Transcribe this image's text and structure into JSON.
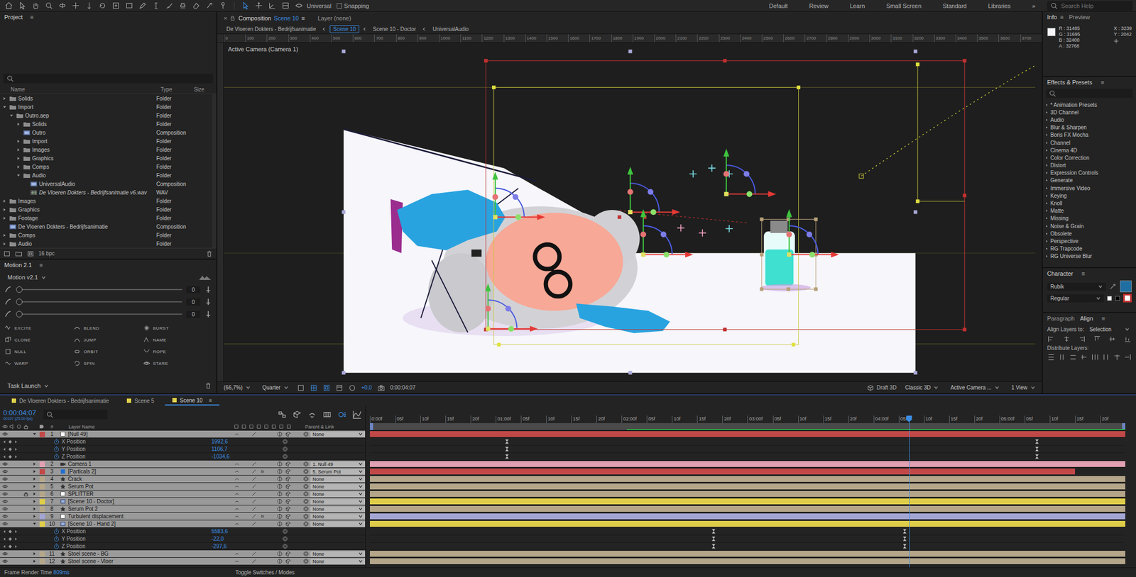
{
  "toolbar": {
    "universal": "Universal",
    "snapping": {
      "label": "Snapping",
      "checked": false
    },
    "workspaces": [
      "Default",
      "Review",
      "Learn",
      "Small Screen",
      "Standard",
      "Libraries"
    ],
    "more": "»",
    "search_placeholder": "Search Help"
  },
  "project": {
    "title": "Project",
    "menu": "≡",
    "columns": [
      "Name",
      "Type",
      "Size"
    ],
    "items": [
      {
        "name": "Solids",
        "type": "Folder",
        "kind": "folder",
        "expanded": false,
        "missing": false
      },
      {
        "name": "Import",
        "type": "Folder",
        "kind": "folder",
        "expanded": true,
        "missing": false,
        "children": [
          {
            "name": "Outro.aep",
            "type": "Folder",
            "kind": "folder",
            "expanded": true,
            "missing": false,
            "children": [
              {
                "name": "Solids",
                "type": "Folder",
                "kind": "folder",
                "expanded": false,
                "missing": false
              },
              {
                "name": "Outro",
                "type": "Composition",
                "kind": "comp",
                "missing": false
              },
              {
                "name": "Import",
                "type": "Folder",
                "kind": "folder",
                "expanded": false,
                "missing": false
              },
              {
                "name": "Images",
                "type": "Folder",
                "kind": "folder",
                "expanded": false,
                "missing": false
              },
              {
                "name": "Graphics",
                "type": "Folder",
                "kind": "folder",
                "expanded": false,
                "missing": false
              },
              {
                "name": "Comps",
                "type": "Folder",
                "kind": "folder",
                "expanded": false,
                "missing": false
              },
              {
                "name": "Audio",
                "type": "Folder",
                "kind": "folder",
                "expanded": true,
                "missing": false,
                "children": [
                  {
                    "name": "UniversalAudio",
                    "type": "Composition",
                    "kind": "comp",
                    "missing": false
                  },
                  {
                    "name": "De Vloeren Dokters - Bedrijfsanimatie v6.wav",
                    "type": "WAV",
                    "kind": "audio",
                    "missing": true
                  }
                ]
              }
            ]
          }
        ]
      },
      {
        "name": "Images",
        "type": "Folder",
        "kind": "folder",
        "expanded": false,
        "missing": false
      },
      {
        "name": "Graphics",
        "type": "Folder",
        "kind": "folder",
        "expanded": false,
        "missing": false
      },
      {
        "name": "Footage",
        "type": "Folder",
        "kind": "folder",
        "expanded": false,
        "missing": false
      },
      {
        "name": "De Vloeren Dokters - Bedrijfsanimatie",
        "type": "Composition",
        "kind": "comp",
        "missing": false
      },
      {
        "name": "Comps",
        "type": "Folder",
        "kind": "folder",
        "expanded": false,
        "missing": false
      },
      {
        "name": "Audio",
        "type": "Folder",
        "kind": "folder",
        "expanded": false,
        "missing": false
      }
    ],
    "footer_bpc": "16 bpc"
  },
  "motion": {
    "title": "Motion 2.1",
    "menu": "≡",
    "preset": "Motion v2.1",
    "sliders": [
      {
        "value": "0",
        "level": 0
      },
      {
        "value": "0",
        "level": 0
      },
      {
        "value": "0",
        "level": 0
      }
    ],
    "buttons": [
      "EXCITE",
      "BLEND",
      "BURST",
      "CLONE",
      "JUMP",
      "NAME",
      "NULL",
      "ORBIT",
      "ROPE",
      "WARP",
      "SPIN",
      "STARE"
    ],
    "task": "Task Launch"
  },
  "viewer": {
    "tabs": [
      {
        "label": "Composition",
        "sub": "Scene 10",
        "close": "×",
        "menu": "≡",
        "selected": true
      },
      {
        "label": "Layer (none)",
        "sub": "",
        "close": "",
        "menu": "",
        "selected": false
      }
    ],
    "breadcrumbs": [
      {
        "label": "De Vloeren Dokters - Bedrijfsanimatie",
        "selected": false
      },
      {
        "label": "Scene 10",
        "selected": true
      },
      {
        "label": "Scene 10 - Doctor",
        "selected": false
      },
      {
        "label": "UniversalAudio",
        "selected": false
      }
    ],
    "ruler": [
      "0",
      "100",
      "200",
      "300",
      "400",
      "500",
      "600",
      "700",
      "800",
      "900",
      "1000",
      "1100",
      "1200",
      "1300",
      "1400",
      "1500",
      "1600",
      "1700",
      "1800",
      "1900",
      "2000",
      "2100",
      "2200",
      "2300",
      "2400",
      "2500",
      "2600",
      "2700",
      "2800",
      "2900",
      "3000",
      "3100",
      "3200",
      "3300",
      "3400",
      "3500",
      "3600",
      "3700"
    ],
    "camera_label": "Active Camera (Camera 1)",
    "footer": {
      "zoom": "(66,7%)",
      "resolution": "Quarter",
      "exposure": "+0,0",
      "time": "0:00:04:07",
      "draft": "Draft 3D",
      "renderer": "Classic 3D",
      "view": "Active Camera ...",
      "layout": "1 View"
    }
  },
  "info": {
    "tabs": [
      {
        "label": "Info",
        "menu": "≡",
        "selected": true
      },
      {
        "label": "Preview",
        "menu": "",
        "selected": false
      }
    ],
    "sample_color": "#f5f6fa",
    "channels": [
      {
        "label": "R :",
        "value": "31485"
      },
      {
        "label": "G :",
        "value": "31695"
      },
      {
        "label": "B :",
        "value": "32400"
      },
      {
        "label": "A :",
        "value": "32768"
      }
    ],
    "coords": [
      {
        "label": "X :",
        "value": "3239"
      },
      {
        "label": "Y :",
        "value": "2042"
      }
    ]
  },
  "effects": {
    "title": "Effects & Presets",
    "menu": "≡",
    "search_placeholder": "",
    "items": [
      "* Animation Presets",
      "3D Channel",
      "Audio",
      "Blur & Sharpen",
      "Boris FX Mocha",
      "Channel",
      "Cinema 4D",
      "Color Correction",
      "Distort",
      "Expression Controls",
      "Generate",
      "Immersive Video",
      "Keying",
      "Knoll",
      "Matte",
      "Missing",
      "Noise & Grain",
      "Obsolete",
      "Perspective",
      "RG Trapcode",
      "RG Universe Blur"
    ]
  },
  "character": {
    "title": "Character",
    "menu": "≡",
    "font": "Rubik",
    "style": "Regular",
    "fill_color": "#1f6fa3"
  },
  "align": {
    "tabs": [
      {
        "label": "Paragraph",
        "selected": false
      },
      {
        "label": "Align",
        "selected": true
      }
    ],
    "menu": "≡",
    "align_to_label": "Align Layers to:",
    "align_to": "Selection",
    "distribute_label": "Distribute Layers:"
  },
  "timeline": {
    "tabs": [
      {
        "label": "De Vloeren Dokters - Bedrijfsanimatie",
        "selected": false
      },
      {
        "label": "Scene 5",
        "selected": false
      },
      {
        "label": "Scene 10",
        "menu": "≡",
        "selected": true
      }
    ],
    "time": "0:00:04:07",
    "frame_info": "00107 (25.00 fps)",
    "search_placeholder": "",
    "columns": {
      "index": "#",
      "name": "Layer Name",
      "parent": "Parent & Link"
    },
    "ruler": [
      "0:00f",
      "05f",
      "10f",
      "15f",
      "20f",
      "01:00f",
      "05f",
      "10f",
      "15f",
      "20f",
      "02:00f",
      "05f",
      "10f",
      "15f",
      "20f",
      "03:00f",
      "05f",
      "10f",
      "15f",
      "20f",
      "04:00f",
      "05f",
      "10f",
      "15f",
      "20f",
      "05:00f",
      "05f",
      "10f",
      "15f",
      "20f"
    ],
    "duration_seconds": 6,
    "playhead_seconds": 4.28,
    "cached_from_seconds": 2.04,
    "effects_label": "fx",
    "layers": [
      {
        "index": "1",
        "name": "[Null 49]",
        "kind": "null",
        "color": "#c24848",
        "parent": "None",
        "selected": true,
        "locked": false,
        "has_effects": false,
        "expanded": true,
        "start": 0,
        "end": 6,
        "properties": [
          {
            "name": "X Position",
            "value": "1992,6",
            "keyframes": [
              1.09,
              5.3
            ]
          },
          {
            "name": "Y Position",
            "value": "1106,7",
            "keyframes": [
              1.09,
              5.3
            ]
          },
          {
            "name": "Z Position",
            "value": "-1034,6",
            "keyframes": [
              1.09,
              5.3
            ]
          }
        ]
      },
      {
        "index": "2",
        "name": "Camera 1",
        "kind": "camera",
        "color": "#e2a1b3",
        "parent": "1. Null 49",
        "selected": true,
        "locked": false,
        "has_effects": false,
        "expanded": false,
        "start": 0,
        "end": 6
      },
      {
        "index": "3",
        "name": "[Particals 2]",
        "kind": "solid",
        "color": "#c24848",
        "parent": "5. Serum Pot",
        "selected": true,
        "locked": false,
        "has_effects": true,
        "expanded": false,
        "start": 0,
        "end": 5.6
      },
      {
        "index": "4",
        "name": "Crack",
        "kind": "shape",
        "color": "#b5a68a",
        "parent": "None",
        "selected": true,
        "locked": false,
        "has_effects": false,
        "expanded": false,
        "start": 0,
        "end": 6
      },
      {
        "index": "5",
        "name": "Serum Pot",
        "kind": "shape",
        "color": "#b5a68a",
        "parent": "None",
        "selected": true,
        "locked": false,
        "has_effects": false,
        "expanded": false,
        "start": 0,
        "end": 6
      },
      {
        "index": "6",
        "name": "SPLITTER",
        "kind": "null",
        "color": "#b5a68a",
        "parent": "None",
        "selected": true,
        "locked": true,
        "has_effects": false,
        "expanded": false,
        "start": 0,
        "end": 6
      },
      {
        "index": "7",
        "name": "[Scene 10 - Doctor]",
        "kind": "precomp",
        "color": "#dfcd4a",
        "parent": "None",
        "selected": true,
        "locked": false,
        "has_effects": false,
        "expanded": false,
        "start": 0,
        "end": 6
      },
      {
        "index": "8",
        "name": "Serum Pot 2",
        "kind": "shape",
        "color": "#b5a68a",
        "parent": "None",
        "selected": true,
        "locked": false,
        "has_effects": false,
        "expanded": false,
        "start": 0,
        "end": 6
      },
      {
        "index": "9",
        "name": "Turbulent displacement",
        "kind": "null",
        "color": "#a3a5d3",
        "parent": "None",
        "selected": true,
        "locked": false,
        "has_effects": true,
        "expanded": false,
        "start": 0,
        "end": 6
      },
      {
        "index": "10",
        "name": "[Scene 10 - Hand 2]",
        "kind": "precomp",
        "color": "#dfcd4a",
        "parent": "None",
        "selected": true,
        "locked": false,
        "has_effects": false,
        "expanded": true,
        "start": 0,
        "end": 6,
        "properties": [
          {
            "name": "X Position",
            "value": "5583,6",
            "keyframes": [
              2.73,
              4.25
            ]
          },
          {
            "name": "Y Position",
            "value": "-22,0",
            "keyframes": [
              2.73,
              4.25
            ]
          },
          {
            "name": "Z Position",
            "value": "-297,6",
            "keyframes": [
              2.73,
              4.25
            ]
          }
        ]
      },
      {
        "index": "11",
        "name": "Stoel scene - BG",
        "kind": "shape",
        "color": "#b5a68a",
        "parent": "None",
        "selected": true,
        "locked": false,
        "has_effects": false,
        "expanded": false,
        "start": 0,
        "end": 6
      },
      {
        "index": "12",
        "name": "Stoel scene - Vloer",
        "kind": "shape",
        "color": "#b5a68a",
        "parent": "None",
        "selected": true,
        "locked": false,
        "has_effects": false,
        "expanded": false,
        "start": 0,
        "end": 6
      }
    ],
    "footer": {
      "render_time_label": "Frame Render Time",
      "render_time": "809ms",
      "toggle": "Toggle Switches / Modes"
    }
  }
}
